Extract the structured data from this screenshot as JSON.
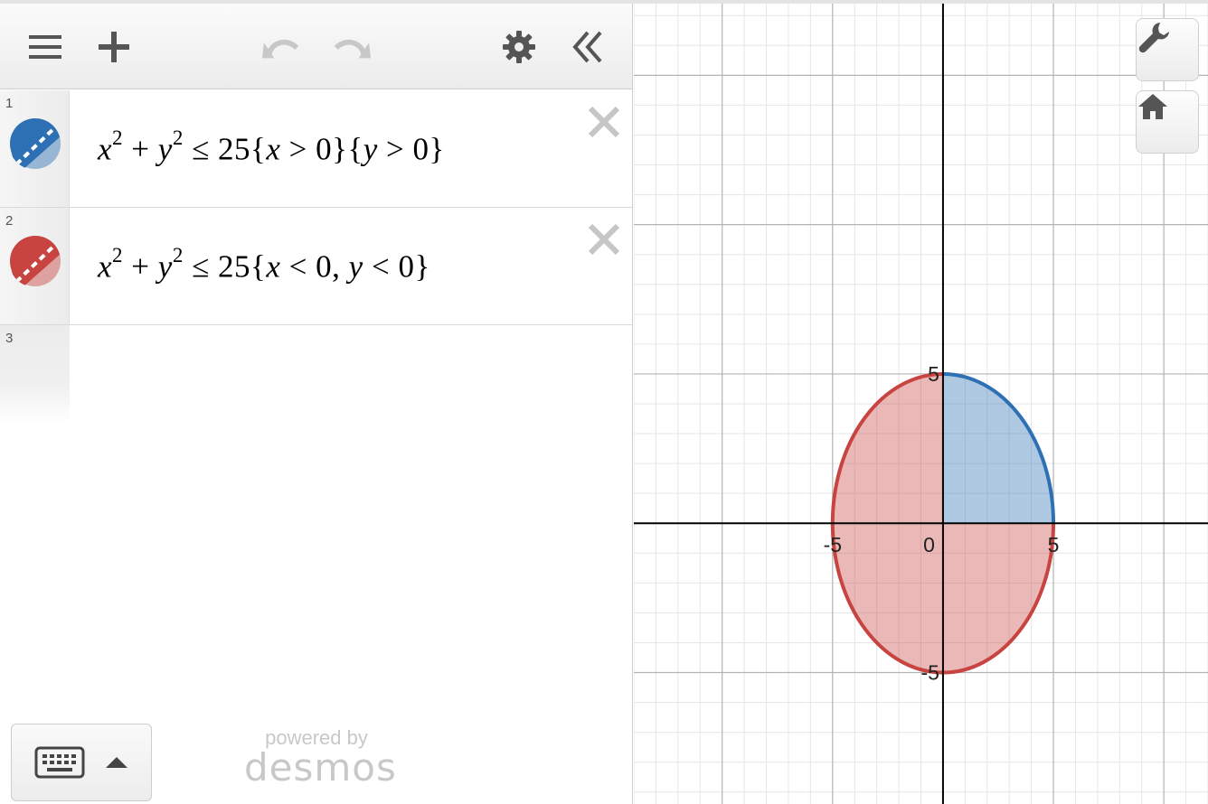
{
  "toolbar": {
    "menu_icon": "hamburger-menu-icon",
    "add_icon": "plus-icon",
    "undo_icon": "undo-arrow-icon",
    "redo_icon": "redo-arrow-icon",
    "settings_icon": "gear-icon",
    "collapse_icon": "double-chevron-left-icon"
  },
  "expressions": [
    {
      "index": "1",
      "color": "#2d70b3",
      "latex_parts": {
        "a": "x",
        "a_exp": "2",
        "op": " + ",
        "b": "y",
        "b_exp": "2",
        "rest": " ≤ 25{",
        "c1": "x",
        "c1r": " > 0}{",
        "c2": "y",
        "c2r": " > 0}"
      }
    },
    {
      "index": "2",
      "color": "#c74440",
      "latex_parts": {
        "a": "x",
        "a_exp": "2",
        "op": " + ",
        "b": "y",
        "b_exp": "2",
        "rest": " ≤ 25{",
        "c1": "x",
        "c1r": " < 0, ",
        "c2": "y",
        "c2r": " < 0}"
      }
    },
    {
      "index": "3"
    }
  ],
  "footer": {
    "keyboard_icon": "keyboard-icon",
    "expand_icon": "caret-up-icon",
    "powered_by": "powered by",
    "brand": "desmos"
  },
  "graph": {
    "x_ticks": [
      "-5",
      "0",
      "5"
    ],
    "y_ticks": [
      "5",
      "-5"
    ],
    "wrench_icon": "wrench-icon",
    "home_icon": "home-icon",
    "colors": {
      "blue": "#2d70b3",
      "red": "#c74440",
      "grid_minor": "#e6e6e6",
      "grid_major": "#b3b3b3",
      "axis": "#000000"
    }
  },
  "chart_data": {
    "type": "region",
    "xlim": [
      -14.0,
      12.0
    ],
    "ylim": [
      -9.4,
      17.4
    ],
    "series": [
      {
        "expression": "x^2+y^2≤25{x>0}{y>0}",
        "color": "#2d70b3"
      },
      {
        "expression": "x^2+y^2≤25{x<0, y<0}",
        "color": "#c74440"
      }
    ],
    "grid": true
  }
}
